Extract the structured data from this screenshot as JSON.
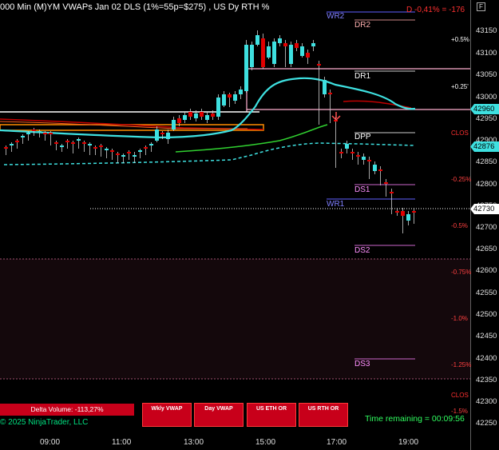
{
  "header": {
    "title": "000 Min (M)YM VWAPs Jan 02 DLS (1%=55p=$275) , US Dy RTH %",
    "delta": "D -0,41% = -176",
    "f_label": "F"
  },
  "price_axis": {
    "labels": [
      "43150",
      "43100",
      "43050",
      "43000",
      "42950",
      "42900",
      "42850",
      "42800",
      "42750",
      "42700",
      "42650",
      "42600",
      "42550",
      "42500",
      "42450",
      "42400",
      "42350",
      "42300",
      "42250"
    ],
    "tags": [
      {
        "value": "42960",
        "color": "#3ee0e0"
      },
      {
        "value": "42876",
        "color": "#3ee0e0"
      },
      {
        "value": "42730",
        "color": "#ffffff"
      }
    ]
  },
  "pct_labels": [
    {
      "text": "+0.5%",
      "color": "#ffffff"
    },
    {
      "text": "+0.25'",
      "color": "#ffffff"
    },
    {
      "text": "CLOS",
      "color": "#ff3030"
    },
    {
      "text": "-0.25%",
      "color": "#ff4040"
    },
    {
      "text": "-0.5%",
      "color": "#ff4040"
    },
    {
      "text": "-0.75%",
      "color": "#ff4040"
    },
    {
      "text": "-1.0%",
      "color": "#ff4040"
    },
    {
      "text": "-1.25%",
      "color": "#ff4040"
    },
    {
      "text": "CLOS",
      "color": "#ff3030"
    },
    {
      "text": "-1.5%",
      "color": "#ff4040"
    }
  ],
  "levels": [
    {
      "text": "WR2",
      "color": "#8080ff"
    },
    {
      "text": "DR2",
      "color": "#ffb0b0"
    },
    {
      "text": "DR1",
      "color": "#ffffff"
    },
    {
      "text": "DPP",
      "color": "#ffffff"
    },
    {
      "text": "DS1",
      "color": "#ff90ff"
    },
    {
      "text": "WR1",
      "color": "#8080ff"
    },
    {
      "text": "DS2",
      "color": "#ff90ff"
    },
    {
      "text": "DS3",
      "color": "#ff90ff"
    }
  ],
  "time_axis": [
    "09:00",
    "11:00",
    "13:00",
    "15:00",
    "17:00",
    "19:00"
  ],
  "footer": {
    "delta_volume": "Delta Volume: -113,27%",
    "copyright": "© 2025 NinjaTrader, LLC",
    "time_remaining": "Time remaining = 00:09:56",
    "buttons": [
      "Wkly VWAP",
      "Day VWAP",
      "US ETH OR",
      "US RTH OR"
    ]
  },
  "colors": {
    "bull": "#3ee0e0",
    "bear": "#e00000",
    "vwap": "#3ee0e0",
    "green_line": "#30d030",
    "orange_box": "#ff8c00"
  }
}
